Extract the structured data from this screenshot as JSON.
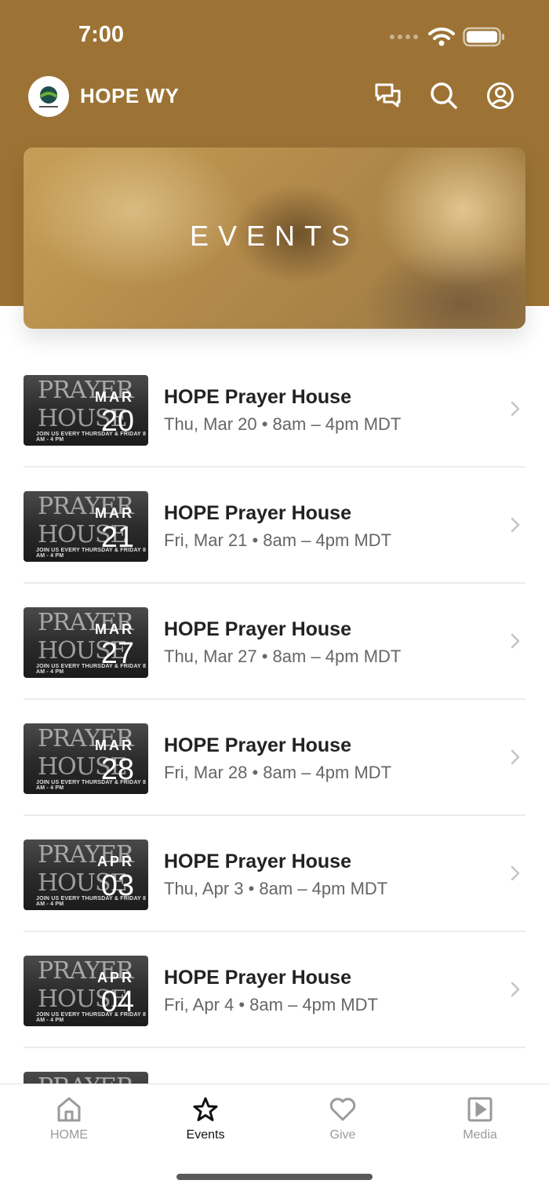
{
  "status": {
    "time": "7:00"
  },
  "header": {
    "app_title": "HOPE WY",
    "chat_icon": "chat-bubbles-icon",
    "search_icon": "search-icon",
    "profile_icon": "profile-icon"
  },
  "hero": {
    "title": "EVENTS"
  },
  "colors": {
    "brand": "#9c7335",
    "text": "#222222",
    "muted": "#666666"
  },
  "events": [
    {
      "thumb_month": "MAR",
      "thumb_day": "20",
      "title": "HOPE Prayer House",
      "subtitle": "Thu, Mar 20 • 8am – 4pm MDT"
    },
    {
      "thumb_month": "MAR",
      "thumb_day": "21",
      "title": "HOPE Prayer House",
      "subtitle": "Fri, Mar 21 • 8am – 4pm MDT"
    },
    {
      "thumb_month": "MAR",
      "thumb_day": "27",
      "title": "HOPE Prayer House",
      "subtitle": "Thu, Mar 27 • 8am – 4pm MDT"
    },
    {
      "thumb_month": "MAR",
      "thumb_day": "28",
      "title": "HOPE Prayer House",
      "subtitle": "Fri, Mar 28 • 8am – 4pm MDT"
    },
    {
      "thumb_month": "APR",
      "thumb_day": "03",
      "title": "HOPE Prayer House",
      "subtitle": "Thu, Apr 3 • 8am – 4pm MDT"
    },
    {
      "thumb_month": "APR",
      "thumb_day": "04",
      "title": "HOPE Prayer House",
      "subtitle": "Fri, Apr 4 • 8am – 4pm MDT"
    }
  ],
  "thumb_text": {
    "line1": "PRAYER",
    "line2": "HOUSE",
    "tagline": "JOIN US EVERY THURSDAY & FRIDAY 8 AM - 4 PM"
  },
  "tabs": [
    {
      "label": "HOME",
      "icon": "home-icon"
    },
    {
      "label": "Events",
      "icon": "star-icon"
    },
    {
      "label": "Give",
      "icon": "heart-icon"
    },
    {
      "label": "Media",
      "icon": "play-icon"
    }
  ]
}
